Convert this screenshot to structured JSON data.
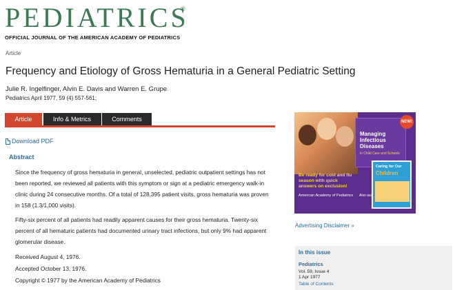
{
  "header": {
    "logo_text": "PEDIATRICS",
    "registered_mark": "®",
    "subtitle": "OFFICIAL JOURNAL OF THE AMERICAN ACADEMY OF PEDIATRICS"
  },
  "article": {
    "type": "Article",
    "title": "Frequency and Etiology of Gross Hematuria in a General Pediatric Setting",
    "authors": "Julie R. Ingelfinger, Alvin E. Davis and Warren E. Grupe",
    "citation": "Pediatrics April 1977, 59 (4) 557-561;"
  },
  "tabs": [
    {
      "label": "Article",
      "active": true
    },
    {
      "label": "Info & Metrics",
      "active": false
    },
    {
      "label": "Comments",
      "active": false
    }
  ],
  "download_pdf": "Download PDF",
  "abstract": {
    "heading": "Abstract",
    "paragraph1": "Since the frequency of gross hematuria in general, unselected, pediatric outpatient settings has not been reported, we reviewed all patients with this symptom or sign at a pediatric emergency walk-in clinic during 24 consecutive months. Of a total of 128,395 patient visits, gross hematuria was proven in 158 (1.3/1,000 visits).",
    "paragraph2": "Fifty-six percent of all patients had readily apparent causes for their gross hematuria. Twenty-six percent of all hematuric patients had documented urinary tract infections, but only 9% had apparent glomerular disease.",
    "received": "Received August 4, 1976.",
    "accepted": "Accepted October 13, 1976.",
    "copyright": "Copyright © 1977 by the American Academy of Pediatrics"
  },
  "advertisement": {
    "new_badge": "NEW!",
    "book1_title": "Managing Infectious Diseases",
    "book1_subtitle": "in Child Care and Schools",
    "tagline": "Be ready for cold and flu season with quick answers on exclusion!",
    "publisher": "American Academy of Pediatrics",
    "book2_top": "Caring for Our",
    "book2_title": "Children",
    "also": "Also available!"
  },
  "ad_disclaimer": "Advertising Disclaimer »",
  "in_this_issue": {
    "heading": "In this issue",
    "journal": "Pediatrics",
    "volume": "Vol. 59, Issue 4",
    "date": "1 Apr 1977",
    "toc": "Table of Contents"
  },
  "colors": {
    "brand_green": "#3c7a55",
    "tab_active": "#d1462e",
    "tab_inactive": "#2a2a2a",
    "link_blue": "#2a6c9c",
    "ad_purple": "#5b2d8c"
  }
}
